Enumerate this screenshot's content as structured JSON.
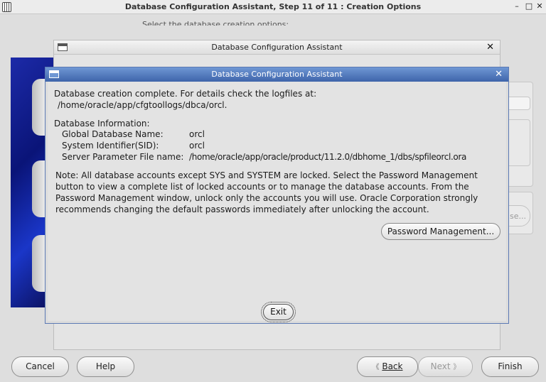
{
  "main_window": {
    "title": "Database Configuration Assistant, Step 11 of 11 : Creation Options",
    "min_glyph": "–",
    "max_glyph": "□",
    "close_glyph": "✕",
    "instruction": "Select the database creation options:"
  },
  "background": {
    "partial_button": "se...",
    "nav": {
      "cancel": "Cancel",
      "help": "Help",
      "back": "Back",
      "back_glyph": "《",
      "next": "Next",
      "next_glyph": "》",
      "finish": "Finish"
    }
  },
  "mid_dialog": {
    "title": "Database Configuration Assistant",
    "close_glyph": "✕"
  },
  "dialog": {
    "title": "Database Configuration Assistant",
    "close_glyph": "✕",
    "complete_line1": "Database creation complete. For details check the logfiles at:",
    "complete_line2": "/home/oracle/app/cfgtoollogs/dbca/orcl.",
    "info_heading": "Database Information:",
    "info": [
      {
        "label": "Global Database Name:",
        "value": "orcl"
      },
      {
        "label": "System Identifier(SID):",
        "value": "orcl"
      },
      {
        "label": "Server Parameter File name:",
        "value": "/home/oracle/app/oracle/product/11.2.0/dbhome_1/dbs/spfileorcl.ora"
      }
    ],
    "note_lines": [
      "Note: All database accounts except SYS and SYSTEM are locked. Select the Password Management",
      "button to view a complete list of locked accounts or to manage the database accounts. From the",
      "Password Management window, unlock only the accounts you will use. Oracle Corporation strongly",
      "recommends changing the default passwords immediately after unlocking the account."
    ],
    "password_button": "Password Management...",
    "exit_button": "Exit"
  },
  "colors": {
    "dialog_title_gradient_top": "#6f97d4",
    "dialog_title_gradient_bottom": "#3e64aa",
    "side_image_blue": "#0a1478"
  },
  "icons": [
    "app-icon",
    "window-icon",
    "close-icon",
    "back-arrow-icon",
    "next-arrow-icon"
  ]
}
